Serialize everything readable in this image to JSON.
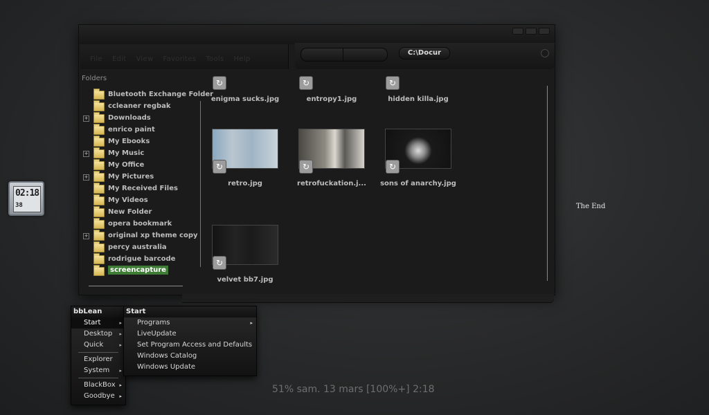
{
  "explorer": {
    "menu": [
      "File",
      "Edit",
      "View",
      "Favorites",
      "Tools",
      "Help"
    ],
    "address": "C:\\Docur",
    "folders_header": "Folders",
    "folders": [
      {
        "name": "Bluetooth Exchange Folder",
        "expandable": false,
        "selected": false
      },
      {
        "name": "ccleaner regbak",
        "expandable": false,
        "selected": false
      },
      {
        "name": "Downloads",
        "expandable": true,
        "selected": false
      },
      {
        "name": "enrico paint",
        "expandable": false,
        "selected": false
      },
      {
        "name": "My Ebooks",
        "expandable": false,
        "selected": false
      },
      {
        "name": "My Music",
        "expandable": true,
        "selected": false
      },
      {
        "name": "My Office",
        "expandable": false,
        "selected": false
      },
      {
        "name": "My Pictures",
        "expandable": true,
        "selected": false
      },
      {
        "name": "My Received Files",
        "expandable": false,
        "selected": false
      },
      {
        "name": "My Videos",
        "expandable": false,
        "selected": false
      },
      {
        "name": "New Folder",
        "expandable": false,
        "selected": false
      },
      {
        "name": "opera bookmark",
        "expandable": false,
        "selected": false
      },
      {
        "name": "original xp theme copy",
        "expandable": true,
        "selected": false
      },
      {
        "name": "percy australia",
        "expandable": false,
        "selected": false
      },
      {
        "name": "rodrigue barcode",
        "expandable": false,
        "selected": false
      },
      {
        "name": "screencapture",
        "expandable": false,
        "selected": true
      }
    ],
    "files": [
      {
        "name": "enigma sucks.jpg",
        "thumb": "partial"
      },
      {
        "name": "entropy1.jpg",
        "thumb": "partial"
      },
      {
        "name": "hidden killa.jpg",
        "thumb": "partial"
      },
      {
        "name": "retro.jpg",
        "thumb": "retro"
      },
      {
        "name": "retrofuckation.j...",
        "thumb": "retrofuck"
      },
      {
        "name": "sons of anarchy.jpg",
        "thumb": "soa"
      },
      {
        "name": "velvet bb7.jpg",
        "thumb": "velvet"
      }
    ]
  },
  "clock": {
    "main": "02:18",
    "seconds": "38"
  },
  "desktop_text": "The End",
  "bblean_menu": {
    "title": "bbLean",
    "items": [
      {
        "label": "Start",
        "submenu": true,
        "active": true
      },
      {
        "label": "Desktop",
        "submenu": true
      },
      {
        "label": "Quick",
        "submenu": true
      },
      {
        "sep": true
      },
      {
        "label": "Explorer",
        "submenu": false
      },
      {
        "label": "System",
        "submenu": true
      },
      {
        "sep": true
      },
      {
        "label": "BlackBox",
        "submenu": true
      },
      {
        "label": "Goodbye",
        "submenu": true
      }
    ]
  },
  "start_menu": {
    "title": "Start",
    "items": [
      {
        "label": "Programs",
        "submenu": true
      },
      {
        "label": "LiveUpdate",
        "submenu": false
      },
      {
        "label": "Set Program Access and Defaults",
        "submenu": false
      },
      {
        "label": "Windows Catalog",
        "submenu": false
      },
      {
        "label": "Windows Update",
        "submenu": false
      }
    ]
  },
  "status_line": "51% sam. 13 mars   [100%+] 2:18",
  "colors": {
    "selection": "#3f7d37",
    "folder": "#e6cf7d",
    "background": "#2b2c2d"
  }
}
